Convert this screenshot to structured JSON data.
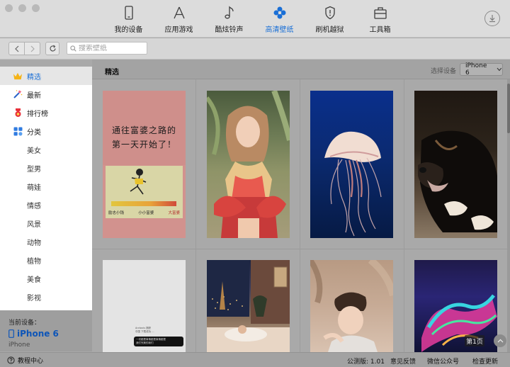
{
  "nav": {
    "items": [
      {
        "label": "我的设备",
        "icon": "phone-icon"
      },
      {
        "label": "应用游戏",
        "icon": "app-store-icon"
      },
      {
        "label": "酷炫铃声",
        "icon": "music-note-icon"
      },
      {
        "label": "高清壁纸",
        "icon": "flower-icon",
        "active": true
      },
      {
        "label": "刷机越狱",
        "icon": "shield-icon"
      },
      {
        "label": "工具箱",
        "icon": "toolbox-icon"
      }
    ]
  },
  "search": {
    "placeholder": "搜索壁纸"
  },
  "sidebar": {
    "items": [
      {
        "label": "精选",
        "icon": "crown-icon",
        "active": true
      },
      {
        "label": "最新",
        "icon": "magic-wand-icon"
      },
      {
        "label": "排行榜",
        "icon": "medal-icon"
      },
      {
        "label": "分类",
        "icon": "category-grid-icon"
      }
    ],
    "subcategories": [
      "美女",
      "型男",
      "萌娃",
      "情感",
      "风景",
      "动物",
      "植物",
      "美食",
      "影视"
    ]
  },
  "device": {
    "caption": "当前设备：",
    "name": "iPhone 6",
    "model": "iPhone"
  },
  "main": {
    "title": "精选",
    "select_device_label": "选择设备",
    "selected_device": "iPhone 6",
    "page_badge": "第1页"
  },
  "wallpapers": [
    {
      "name": "wallpaper-cartoon-motivation",
      "text_lines": [
        "通往富婆之路的",
        "第一天开始了！"
      ],
      "bar_labels": [
        "励志小钱",
        "小小富婆",
        "大富婆"
      ]
    },
    {
      "name": "wallpaper-girl-red-dress"
    },
    {
      "name": "wallpaper-jellyfish"
    },
    {
      "name": "wallpaper-black-puppy"
    },
    {
      "name": "wallpaper-chat-text",
      "text_lines": [
        "Arctaxis 捕获",
        "中国 下载成功 ...",
        "一切都是事情都是事情都是",
        "我们完美的我们"
      ]
    },
    {
      "name": "wallpaper-paris-night-room"
    },
    {
      "name": "wallpaper-boy-portrait"
    },
    {
      "name": "wallpaper-colorful-abstract"
    }
  ],
  "footer": {
    "help": "教程中心",
    "version": "公测版: 1.01",
    "feedback": "意见反馈",
    "wechat": "微信公众号",
    "update": "检查更新"
  }
}
